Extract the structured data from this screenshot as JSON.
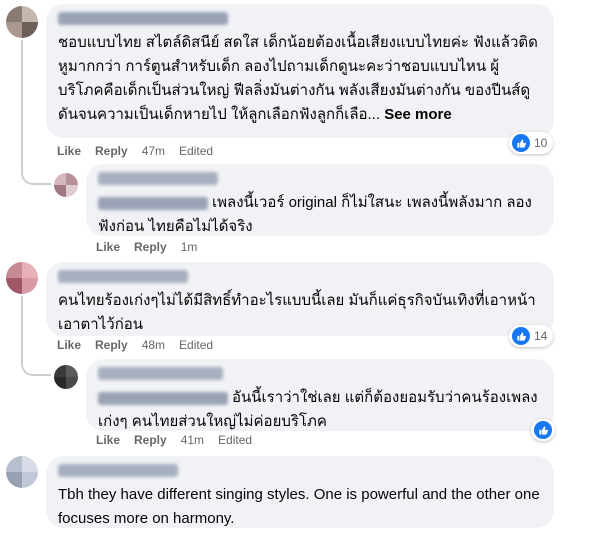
{
  "comments": [
    {
      "text": "ชอบแบบไทย สไตล์ดิสนีย์ สดใส เด็กน้อยต้องเนื้อเสียงแบบไทยค่ะ ฟังแล้วติดหูมากกว่า การ์ตูนสำหรับเด็ก ลองไปถามเด็กดูนะคะว่าชอบแบบไหน ผู้บริโภคคือเด็กเป็นส่วนใหญ่ ฟีลลิ่งมันต่างกัน พลังเสียงมันต่างกัน ของปีนส์ดูดันจนความเป็นเด็กหายไป ให้ลูกเลือกฟังลูกก็เลือ...",
      "see_more": "See more",
      "like": "Like",
      "reply": "Reply",
      "time": "47m",
      "edited": "Edited",
      "reactions": "10"
    },
    {
      "text": "เพลงนี้เวอร์ original ก็ไม่ใสนะ เพลงนี้พลังมาก ลองฟังก่อน ไทยคือไม่ได้จริง",
      "like": "Like",
      "reply": "Reply",
      "time": "1m"
    },
    {
      "text": "คนไทยร้องเก่งๆไม่ได้มีสิทธิ์ทำอะไรแบบนี้เลย มันก็แค่ธุรกิจบันเทิงที่เอาหน้าเอาตาไว้ก่อน",
      "like": "Like",
      "reply": "Reply",
      "time": "48m",
      "edited": "Edited",
      "reactions": "14"
    },
    {
      "text": "อันนี้เราว่าใช่เลย แต่ก็ต้องยอมรับว่าคนร้องเพลงเก่งๆ คนไทยส่วนใหญ่ไม่ค่อยบริโภค",
      "like": "Like",
      "reply": "Reply",
      "time": "41m",
      "edited": "Edited"
    },
    {
      "text": "Tbh they have different singing styles. One is powerful and the other one focuses more on harmony."
    }
  ],
  "colors": {
    "bubble": "#f0f2f5",
    "meta_text": "#65676b",
    "like_blue": "#1877f2"
  },
  "icons": [
    "like-reaction-icon"
  ]
}
